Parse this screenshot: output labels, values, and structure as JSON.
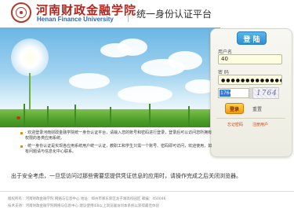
{
  "header": {
    "school_name_cn": "河南财政金融学院",
    "school_name_en": "Henan Finance University",
    "system_title": "统一身份认证平台"
  },
  "login": {
    "tab_label": "登 陆",
    "username_label": "用户名",
    "username_value": "40",
    "password_label": "密 码",
    "password_mask": "●●●●●●●●●●●●●●●●",
    "captcha_input_value": "1764",
    "captcha_image_text": "1764",
    "login_button": "登录",
    "reset_link": "重置",
    "link_left": "忘记密码",
    "link_right": "注册用户"
  },
  "notes": [
    "· 欢迎登录河南财政金融学院统一身份认证平台，请输入您的账号和密码进行登录，登录后可以访问您所拥有权限的各类应用系统。",
    "· 统一身份认证是实现各应用系统用户统一认证，教职工和学生只需一个账号、密码即可访问，欢迎使用，如有问题请与信息化中心联系。"
  ],
  "security_tip": "出于安全考虑，一旦您访问过那些需要您提供凭证信息的应用时，请操作完成之后关闭浏览器。",
  "footer": {
    "line1": "版权所有：河南财政金融学院 网络与信息中心   地址：郑州市郑东新区龙子湖高校园区   邮编：450046",
    "line2": "技术支持：河南财政金融学院网络与信息中心   建议使用IE8以上浏览器访问本系统以获得最佳体验"
  }
}
